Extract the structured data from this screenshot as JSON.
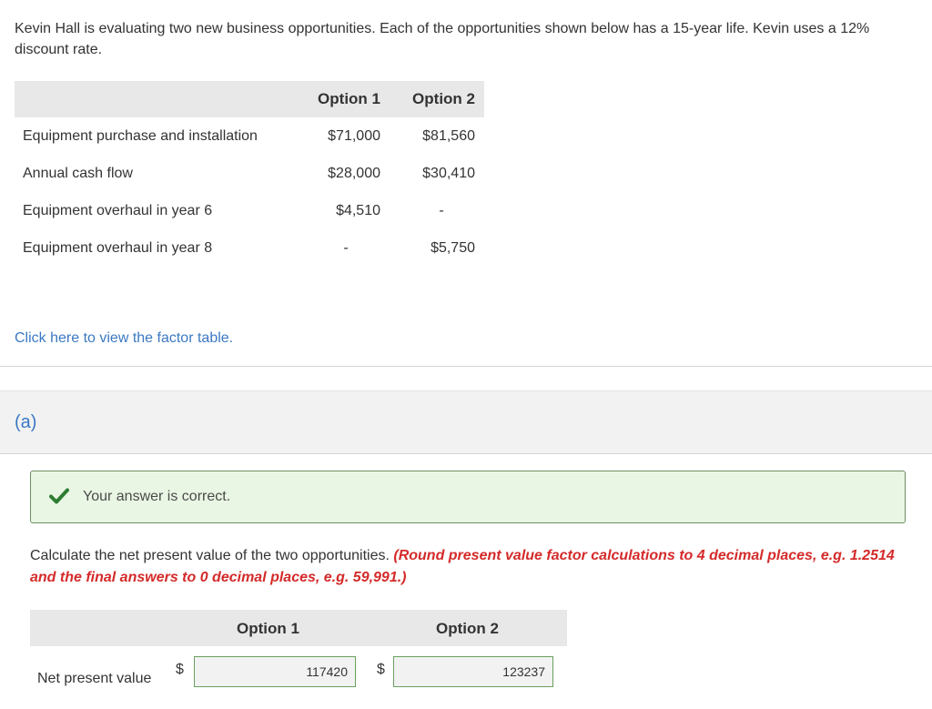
{
  "intro": "Kevin Hall is evaluating two new business opportunities. Each of the opportunities shown below has a 15-year life. Kevin uses a 12% discount rate.",
  "options_table": {
    "headers": [
      "Option 1",
      "Option 2"
    ],
    "rows": [
      {
        "label": "Equipment purchase and installation",
        "option1": "$71,000",
        "option2": "$81,560"
      },
      {
        "label": "Annual cash flow",
        "option1": "$28,000",
        "option2": "$30,410"
      },
      {
        "label": "Equipment overhaul in year 6",
        "option1": "$4,510",
        "option2": "-"
      },
      {
        "label": "Equipment overhaul in year 8",
        "option1": "-",
        "option2": "$5,750"
      }
    ]
  },
  "factor_link": "Click here to view the factor table.",
  "part_label": "(a)",
  "feedback": {
    "text": "Your answer is correct.",
    "icon": "checkmark-icon",
    "color": "#2e7d32"
  },
  "question": {
    "text": "Calculate the net present value of the two opportunities. ",
    "hint": "(Round present value factor calculations to 4 decimal places, e.g. 1.2514 and the final answers to 0 decimal places, e.g. 59,991.)"
  },
  "answer_table": {
    "headers": [
      "Option 1",
      "Option 2"
    ],
    "row_label": "Net present value",
    "currency": "$",
    "values": [
      "117420",
      "123237"
    ]
  },
  "colors": {
    "link": "#3b78c2",
    "hint_red": "#d42a2a",
    "correct_bg": "#eaf6e4",
    "correct_border": "#6f8f63"
  }
}
